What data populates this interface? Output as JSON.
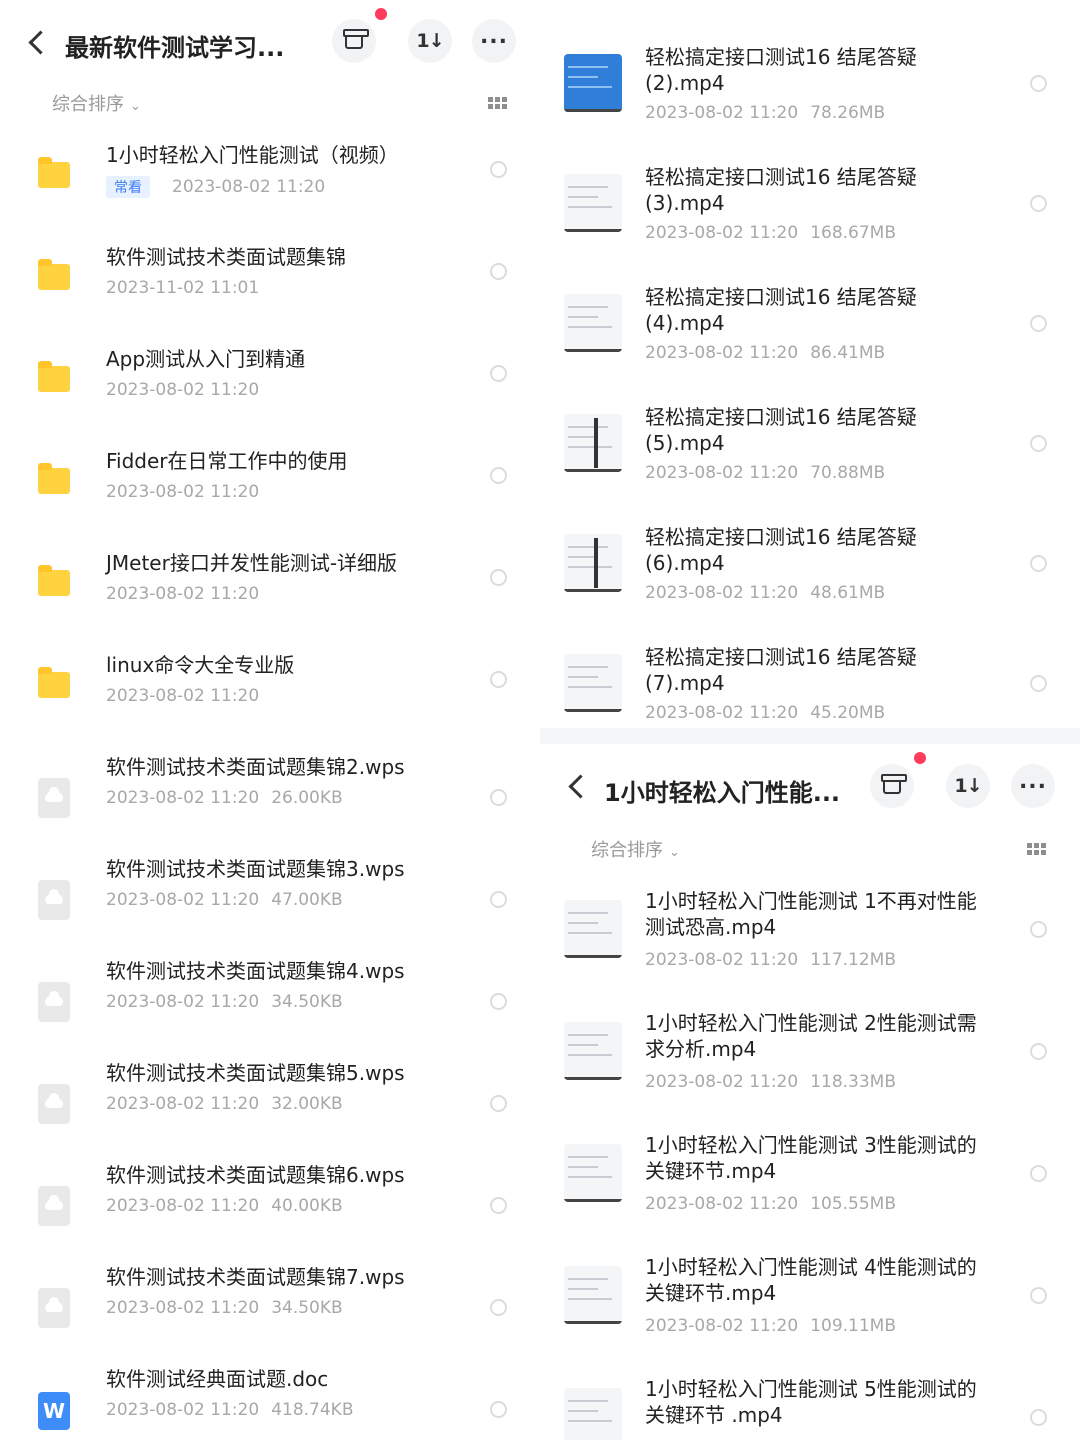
{
  "left": {
    "header": {
      "title": "最新软件测试学习..."
    },
    "sort_label": "综合排序",
    "items": [
      {
        "name": "1小时轻松入门性能测试（视频）",
        "tag": "常看",
        "date": "2023-08-02  11:20",
        "size": "",
        "type": "folder"
      },
      {
        "name": "软件测试技术类面试题集锦",
        "tag": "",
        "date": "2023-11-02  11:01",
        "size": "",
        "type": "folder"
      },
      {
        "name": "App测试从入门到精通",
        "tag": "",
        "date": "2023-08-02  11:20",
        "size": "",
        "type": "folder"
      },
      {
        "name": "Fidder在日常工作中的使用",
        "tag": "",
        "date": "2023-08-02  11:20",
        "size": "",
        "type": "folder"
      },
      {
        "name": "JMeter接口并发性能测试-详细版",
        "tag": "",
        "date": "2023-08-02  11:20",
        "size": "",
        "type": "folder"
      },
      {
        "name": "linux命令大全专业版",
        "tag": "",
        "date": "2023-08-02  11:20",
        "size": "",
        "type": "folder"
      },
      {
        "name": "软件测试技术类面试题集锦2.wps",
        "tag": "",
        "date": "2023-08-02  11:20",
        "size": "26.00KB",
        "type": "wps"
      },
      {
        "name": "软件测试技术类面试题集锦3.wps",
        "tag": "",
        "date": "2023-08-02  11:20",
        "size": "47.00KB",
        "type": "wps"
      },
      {
        "name": "软件测试技术类面试题集锦4.wps",
        "tag": "",
        "date": "2023-08-02  11:20",
        "size": "34.50KB",
        "type": "wps"
      },
      {
        "name": "软件测试技术类面试题集锦5.wps",
        "tag": "",
        "date": "2023-08-02  11:20",
        "size": "32.00KB",
        "type": "wps"
      },
      {
        "name": "软件测试技术类面试题集锦6.wps",
        "tag": "",
        "date": "2023-08-02  11:20",
        "size": "40.00KB",
        "type": "wps"
      },
      {
        "name": "软件测试技术类面试题集锦7.wps",
        "tag": "",
        "date": "2023-08-02  11:20",
        "size": "34.50KB",
        "type": "wps"
      },
      {
        "name": "软件测试经典面试题.doc",
        "tag": "",
        "date": "2023-08-02  11:20",
        "size": "418.74KB",
        "type": "doc"
      }
    ]
  },
  "right_top": {
    "items": [
      {
        "name": "轻松搞定接口测试16 结尾答疑(2).mp4",
        "date": "2023-08-02  11:20",
        "size": "78.26MB",
        "thumb": "blue"
      },
      {
        "name": "轻松搞定接口测试16 结尾答疑(3).mp4",
        "date": "2023-08-02  11:20",
        "size": "168.67MB",
        "thumb": "light"
      },
      {
        "name": "轻松搞定接口测试16 结尾答疑(4).mp4",
        "date": "2023-08-02  11:20",
        "size": "86.41MB",
        "thumb": "light"
      },
      {
        "name": "轻松搞定接口测试16 结尾答疑(5).mp4",
        "date": "2023-08-02  11:20",
        "size": "70.88MB",
        "thumb": "dark"
      },
      {
        "name": "轻松搞定接口测试16 结尾答疑(6).mp4",
        "date": "2023-08-02  11:20",
        "size": "48.61MB",
        "thumb": "dark"
      },
      {
        "name": "轻松搞定接口测试16 结尾答疑(7).mp4",
        "date": "2023-08-02  11:20",
        "size": "45.20MB",
        "thumb": "light"
      }
    ]
  },
  "right_bottom": {
    "header": {
      "title": "1小时轻松入门性能..."
    },
    "sort_label": "综合排序",
    "items": [
      {
        "name": "1小时轻松入门性能测试 1不再对性能测试恐高.mp4",
        "date": "2023-08-02  11:20",
        "size": "117.12MB"
      },
      {
        "name": "1小时轻松入门性能测试 2性能测试需求分析.mp4",
        "date": "2023-08-02  11:20",
        "size": "118.33MB"
      },
      {
        "name": "1小时轻松入门性能测试 3性能测试的关键环节.mp4",
        "date": "2023-08-02  11:20",
        "size": "105.55MB"
      },
      {
        "name": "1小时轻松入门性能测试 4性能测试的关键环节.mp4",
        "date": "2023-08-02  11:20",
        "size": "109.11MB"
      },
      {
        "name": "1小时轻松入门性能测试 5性能测试的关键环节 .mp4",
        "date": "",
        "size": ""
      }
    ]
  },
  "icons": {
    "back": "chevron-left-icon",
    "archive": "archive-icon",
    "sort": "sort-icon",
    "more": "more-icon",
    "grid": "grid-view-icon"
  },
  "colors": {
    "folder": "#ffd33f",
    "notify_dot": "#ff3b5c",
    "tag_text": "#3d7cf3",
    "meta": "#a8a8a8"
  }
}
